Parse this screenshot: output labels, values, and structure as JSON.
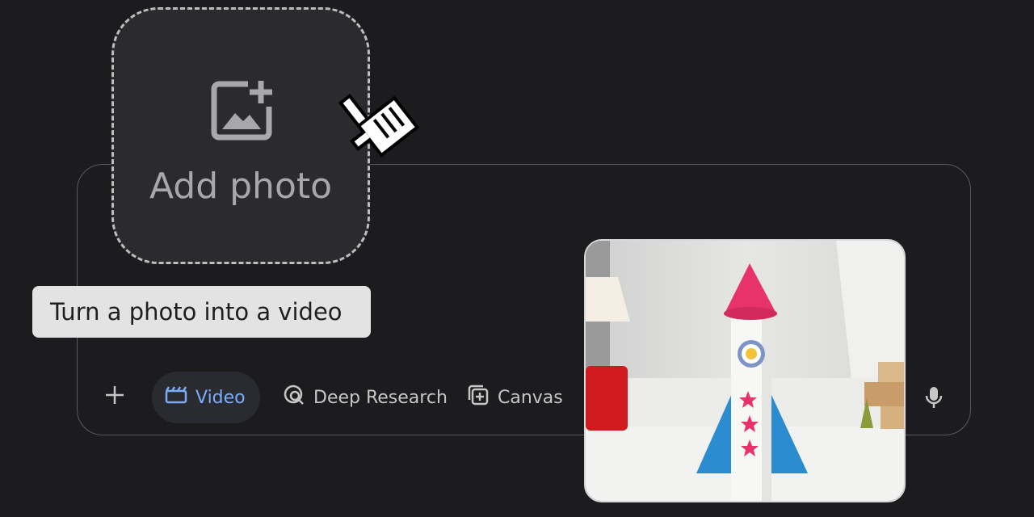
{
  "add_photo": {
    "label": "Add photo",
    "icon": "image-add-icon"
  },
  "tooltip": {
    "text": "Turn a photo into a video"
  },
  "toolbar": {
    "plus_icon": "plus-icon",
    "video_label": "Video",
    "deep_research_label": "Deep Research",
    "canvas_label": "Canvas",
    "mic_icon": "mic-icon"
  },
  "colors": {
    "background": "#1c1c1e",
    "accent": "#7cacf8",
    "chip_active": "#2a2b31",
    "tooltip_bg": "#e3e3e3"
  }
}
